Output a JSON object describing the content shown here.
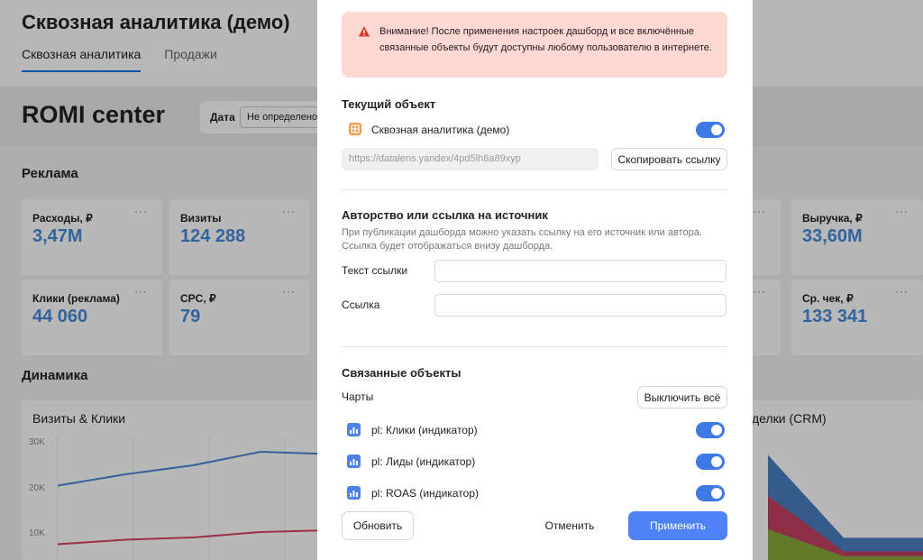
{
  "dashboard": {
    "title": "Сквозная аналитика (демо)",
    "tabs": [
      "Сквозная аналитика",
      "Продажи"
    ],
    "romi_title": "ROMI center",
    "filter_label": "Дата",
    "filter_value": "Не определено",
    "section_ads": "Реклама",
    "section_dynamics": "Динамика",
    "kpis": [
      {
        "label": "Расходы, ₽",
        "value": "3,47M"
      },
      {
        "label": "Визиты",
        "value": "124 288"
      },
      {
        "label": "Клики (реклама)",
        "value": "44 060"
      },
      {
        "label": "CPC, ₽",
        "value": "79"
      },
      {
        "label": "Выручка, ₽",
        "value": "33,60M"
      },
      {
        "label": "Ср. чек, ₽",
        "value": "133 341"
      }
    ],
    "dots": "···",
    "chart_left_title": "Визиты & Клики",
    "chart_right_title": "делки (CRM)",
    "yticks": [
      "30K",
      "20K",
      "10K"
    ]
  },
  "colors": {
    "accent": "#4f82f4",
    "warning_bg": "#ffd7d3",
    "warning_icon": "#d9322a",
    "kpi_value": "#4789d9"
  },
  "chart_data": [
    {
      "type": "line",
      "title": "Визиты & Клики",
      "ylim": [
        0,
        30000
      ],
      "yticks": [
        "30K",
        "20K",
        "10K"
      ],
      "grid": true,
      "series": [
        {
          "color": "#4a86d8",
          "values": [
            20500,
            23000,
            25000,
            28000,
            27500
          ]
        },
        {
          "color": "#d94262",
          "values": [
            7500,
            8500,
            9000,
            10200,
            10600
          ]
        }
      ]
    },
    {
      "type": "area",
      "title": "делки (CRM)",
      "series": [
        {
          "color": "#4a7fc1",
          "values": [
            0.85,
            0.18,
            0.18
          ]
        },
        {
          "color": "#c44063",
          "values": [
            0.52,
            0.07,
            0.07
          ]
        },
        {
          "color": "#8aaa3c",
          "values": [
            0.25,
            0.03,
            0.03
          ]
        }
      ]
    }
  ],
  "modal": {
    "warning": "Внимание! После применения настроек дашборд и все включённые связанные объекты будут доступны любому пользователю в интернете.",
    "current_title": "Текущий объект",
    "current_name": "Сквозная аналитика (демо)",
    "url": "https://datalens.yandex/4pd5lh8a89xyp",
    "copy_label": "Скопировать ссылку",
    "author_title": "Авторство или ссылка на источник",
    "author_desc": "При публикации дашборда можно указать ссылку на его источник или автора. Ссылка будет отображаться внизу дашборда.",
    "link_text_label": "Текст ссылки",
    "link_label": "Ссылка",
    "link_text_value": "",
    "link_value": "",
    "related_title": "Связанные объекты",
    "charts_label": "Чарты",
    "disable_all": "Выключить всё",
    "related": [
      {
        "name": "pl: Клики (индикатор)",
        "enabled": true
      },
      {
        "name": "pl: Лиды (индикатор)",
        "enabled": true
      },
      {
        "name": "pl: ROAS (индикатор)",
        "enabled": true
      }
    ],
    "refresh": "Обновить",
    "cancel": "Отменить",
    "apply": "Применить"
  }
}
